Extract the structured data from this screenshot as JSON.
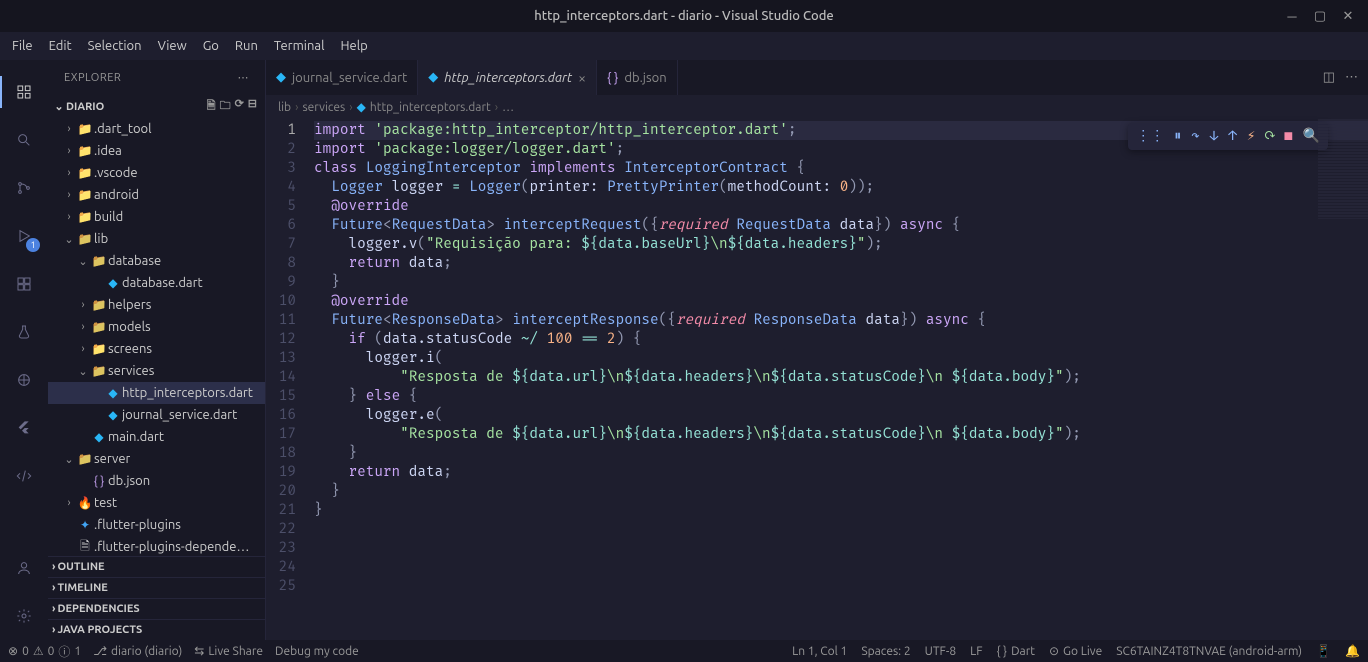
{
  "window": {
    "title": "http_interceptors.dart - diario - Visual Studio Code"
  },
  "menu": [
    "File",
    "Edit",
    "Selection",
    "View",
    "Go",
    "Run",
    "Terminal",
    "Help"
  ],
  "sidebar": {
    "title": "EXPLORER",
    "section": "DIARIO",
    "collapsed_sections": [
      "OUTLINE",
      "TIMELINE",
      "DEPENDENCIES",
      "JAVA PROJECTS"
    ],
    "tree": [
      {
        "indent": 1,
        "chev": "›",
        "icon": "folder-yellow",
        "label": ".dart_tool"
      },
      {
        "indent": 1,
        "chev": "›",
        "icon": "folder-yellow",
        "label": ".idea"
      },
      {
        "indent": 1,
        "chev": "›",
        "icon": "folder-yellow",
        "label": ".vscode"
      },
      {
        "indent": 1,
        "chev": "›",
        "icon": "folder-green",
        "label": "android"
      },
      {
        "indent": 1,
        "chev": "›",
        "icon": "folder-yellow",
        "label": "build"
      },
      {
        "indent": 1,
        "chev": "⌄",
        "icon": "folder-teal",
        "label": "lib"
      },
      {
        "indent": 2,
        "chev": "⌄",
        "icon": "folder-teal",
        "label": "database"
      },
      {
        "indent": 3,
        "chev": "",
        "icon": "dart",
        "label": "database.dart"
      },
      {
        "indent": 2,
        "chev": "›",
        "icon": "folder-teal",
        "label": "helpers"
      },
      {
        "indent": 2,
        "chev": "›",
        "icon": "folder-teal",
        "label": "models"
      },
      {
        "indent": 2,
        "chev": "›",
        "icon": "folder-yellow",
        "label": "screens"
      },
      {
        "indent": 2,
        "chev": "⌄",
        "icon": "folder-teal",
        "label": "services"
      },
      {
        "indent": 3,
        "chev": "",
        "icon": "dart",
        "label": "http_interceptors.dart",
        "selected": true
      },
      {
        "indent": 3,
        "chev": "",
        "icon": "dart",
        "label": "journal_service.dart"
      },
      {
        "indent": 2,
        "chev": "",
        "icon": "dart",
        "label": "main.dart"
      },
      {
        "indent": 1,
        "chev": "⌄",
        "icon": "folder-teal",
        "label": "server"
      },
      {
        "indent": 2,
        "chev": "",
        "icon": "json",
        "label": "db.json"
      },
      {
        "indent": 1,
        "chev": "›",
        "icon": "fire",
        "label": "test"
      },
      {
        "indent": 1,
        "chev": "",
        "icon": "flutter",
        "label": ".flutter-plugins"
      },
      {
        "indent": 1,
        "chev": "",
        "icon": "file",
        "label": ".flutter-plugins-depende…"
      }
    ]
  },
  "activity_badge": "1",
  "tabs": [
    {
      "icon": "dart",
      "name": "journal_service.dart",
      "active": false,
      "close": false
    },
    {
      "icon": "dart",
      "name": "http_interceptors.dart",
      "active": true,
      "close": true
    },
    {
      "icon": "json",
      "name": "db.json",
      "active": false,
      "close": false
    }
  ],
  "breadcrumb": [
    "lib",
    "services",
    "http_interceptors.dart",
    "…"
  ],
  "editor": {
    "line_count": 25,
    "active_line": 1
  },
  "statusbar": {
    "errors": "0",
    "warnings": "0",
    "info": "1",
    "branch": "diario (diario)",
    "live_share": "Live Share",
    "debug_target": "Debug my code",
    "lncol": "Ln 1, Col 1",
    "spaces": "Spaces: 2",
    "encoding": "UTF-8",
    "eol": "LF",
    "lang": "Dart",
    "golive": "Go Live",
    "device": "SC6TAINZ4T8TNVAE (android-arm)"
  },
  "code_tokens": {
    "import": "import",
    "pkg1": "'package:http_interceptor/http_interceptor.dart'",
    "pkg2": "'package:logger/logger.dart'",
    "class": "class",
    "LoggingInterceptor": "LoggingInterceptor",
    "implements": "implements",
    "InterceptorContract": "InterceptorContract",
    "Logger": "Logger",
    "logger_var": "logger",
    "printer": "printer:",
    "PrettyPrinter": "PrettyPrinter",
    "methodCount": "methodCount:",
    "zero": "0",
    "override": "@override",
    "Future": "Future",
    "RequestData": "RequestData",
    "interceptRequest": "interceptRequest",
    "required": "required",
    "data": "data",
    "async": "async",
    "loggerv": "logger.v",
    "req_str1": "\"Requisição para: ",
    "baseUrl": "data.baseUrl",
    "nl": "\\n",
    "headers": "data.headers",
    "return": "return",
    "ResponseData": "ResponseData",
    "interceptResponse": "interceptResponse",
    "if": "if",
    "statusCode": "data.statusCode",
    "tildediv": "~/",
    "hundred": "100",
    "eq": "==",
    "two": "2",
    "loggeri": "logger.i",
    "resp_str": "\"Resposta de ",
    "url": "data.url",
    "body": "data.body",
    "else": "else",
    "loggere": "logger.e"
  }
}
